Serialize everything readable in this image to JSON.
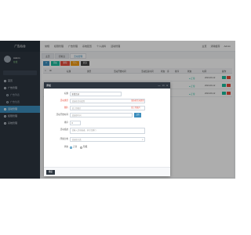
{
  "brand": "广告后台",
  "sidebar": {
    "user_name": "Admin",
    "user_status": "在线",
    "items": [
      {
        "label": "首页"
      },
      {
        "label": "广告管理"
      },
      {
        "label": "广告列表"
      },
      {
        "label": "广告位置"
      },
      {
        "label": "活动管理"
      },
      {
        "label": "权限管理"
      },
      {
        "label": "系统管理"
      }
    ]
  },
  "topbar": {
    "nav": [
      "常规",
      "权限管理",
      "广告管理",
      "系统配置",
      "个人资料",
      "活动管理"
    ],
    "right": [
      "主页",
      "清除缓存",
      "Admin"
    ]
  },
  "tabs": [
    "主页",
    "控制台",
    "活动管理"
  ],
  "toolbar": [
    "",
    "添加",
    "删除",
    "导入",
    "更多"
  ],
  "table": {
    "headers": [
      "ID",
      "标题",
      "类型",
      "活动开始时间",
      "活动结束时间",
      "状态",
      "序",
      "排序",
      "状态",
      "时间",
      "操作"
    ],
    "rows": [
      {
        "status": "● 正常",
        "date": "2024-09-12"
      },
      {
        "status": "● 正常",
        "date": "2024-09-12"
      },
      {
        "status": "● 正常",
        "date": "2024-09-12"
      }
    ]
  },
  "modal": {
    "title": "添加",
    "controls": [
      "—",
      "□",
      "×"
    ],
    "fields": {
      "title_label": "标题",
      "title_value": "新增活动",
      "type_label": "活动类型",
      "type_placeholder": "请选择活动类型",
      "type_error": "请选择活动类型",
      "image_label": "图片",
      "image_placeholder": "请上传图片",
      "image_error": "请上传图片",
      "start_label": "活动开始时间",
      "start_placeholder": "请选择时间",
      "upload_label": "上传",
      "order_label": "排序",
      "order_value": "0",
      "desc_label": "活动描述",
      "desc_placeholder": "请输入活动描述，多行请换行",
      "category_label": "所属分类",
      "category_value": "请选择分类",
      "status_label": "状态",
      "status_normal": "正常",
      "status_hidden": "隐藏"
    },
    "submit": "确定"
  }
}
